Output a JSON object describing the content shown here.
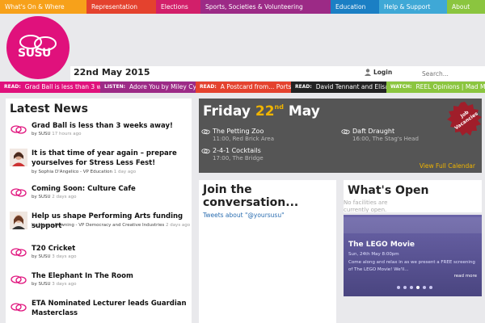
{
  "nav": [
    {
      "label": "What's On & Where",
      "color": "#f7a11a"
    },
    {
      "label": "Representation",
      "color": "#e4422e"
    },
    {
      "label": "Elections",
      "color": "#d21f6a"
    },
    {
      "label": "Sports, Societies & Volunteering",
      "color": "#9c2a86"
    },
    {
      "label": "Education",
      "color": "#1b7fc4"
    },
    {
      "label": "Help & Support",
      "color": "#3fa8d6"
    },
    {
      "label": "About",
      "color": "#8bc53f"
    }
  ],
  "brand": {
    "logo_text": "SUSU",
    "color": "#e0117c"
  },
  "datebar": {
    "date": "22nd May 2015",
    "login": "Login",
    "search_placeholder": "Search..."
  },
  "ticker": [
    {
      "label": "READ:",
      "text": "Grad Ball is less than 3 w...",
      "color": "#e0117c"
    },
    {
      "label": "LISTEN:",
      "text": "Adore You by Miley Cyru...",
      "color": "#9c2a86"
    },
    {
      "label": "READ:",
      "text": "A Postcard from... Portsm...",
      "color": "#e4422e"
    },
    {
      "label": "READ:",
      "text": "David Tennant and Elisab...",
      "color": "#222222"
    },
    {
      "label": "WATCH:",
      "text": "REEL Opinions | Mad M...",
      "color": "#8bc53f"
    }
  ],
  "news": {
    "heading": "Latest News",
    "items": [
      {
        "title": "Grad Ball is less than 3 weeks away!",
        "author": "by SUSU",
        "ago": "17 hours ago",
        "avatar": "susu"
      },
      {
        "title": "It is that time of year again – prepare yourselves for Stress Less Fest!",
        "author": "by Sophia D'Angelico - VP Education",
        "ago": "1 day ago",
        "avatar": "person"
      },
      {
        "title": "Coming Soon: Culture Cafe",
        "author": "by SUSU",
        "ago": "2 days ago",
        "avatar": "susu"
      },
      {
        "title": "Help us shape Performing Arts funding support",
        "author": "by Megan Downing - VP Democracy and Creative Industries",
        "ago": "2 days ago",
        "avatar": "person"
      },
      {
        "title": "T20 Cricket",
        "author": "by SUSU",
        "ago": "3 days ago",
        "avatar": "susu"
      },
      {
        "title": "The Elephant In The Room",
        "author": "by SUSU",
        "ago": "3 days ago",
        "avatar": "susu"
      },
      {
        "title": "ETA Nominated Lecturer leads Guardian Masterclass",
        "author": "",
        "ago": "",
        "avatar": "susu"
      }
    ]
  },
  "calendar": {
    "weekday": "Friday",
    "daynum": "22",
    "suffix": "nd",
    "month": "May",
    "events": [
      {
        "name": "The Petting Zoo",
        "time": "11:00, Red Brick Area"
      },
      {
        "name": "2-4-1 Cocktails",
        "time": "17:00, The Bridge"
      },
      {
        "name": "Daft Draught",
        "time": "16:00, The Stag's Head"
      }
    ],
    "view_link": "View Full Calendar",
    "accent": "#f0b400"
  },
  "jobs_badge": {
    "text1": "Job",
    "text2": "Vacancies",
    "color": "#a01e2a"
  },
  "conversation": {
    "heading": "Join the conversation...",
    "link": "Tweets about \"@yoursusu\""
  },
  "open": {
    "heading": "What's Open",
    "empty": "No facilities are currently open."
  },
  "promo": {
    "title": "The LEGO Movie",
    "date": "Sun, 24th May 8:00pm",
    "desc": "Come along and relax in as we present a FREE screening of The LEGO Movie! We'll...",
    "more": "read more"
  }
}
